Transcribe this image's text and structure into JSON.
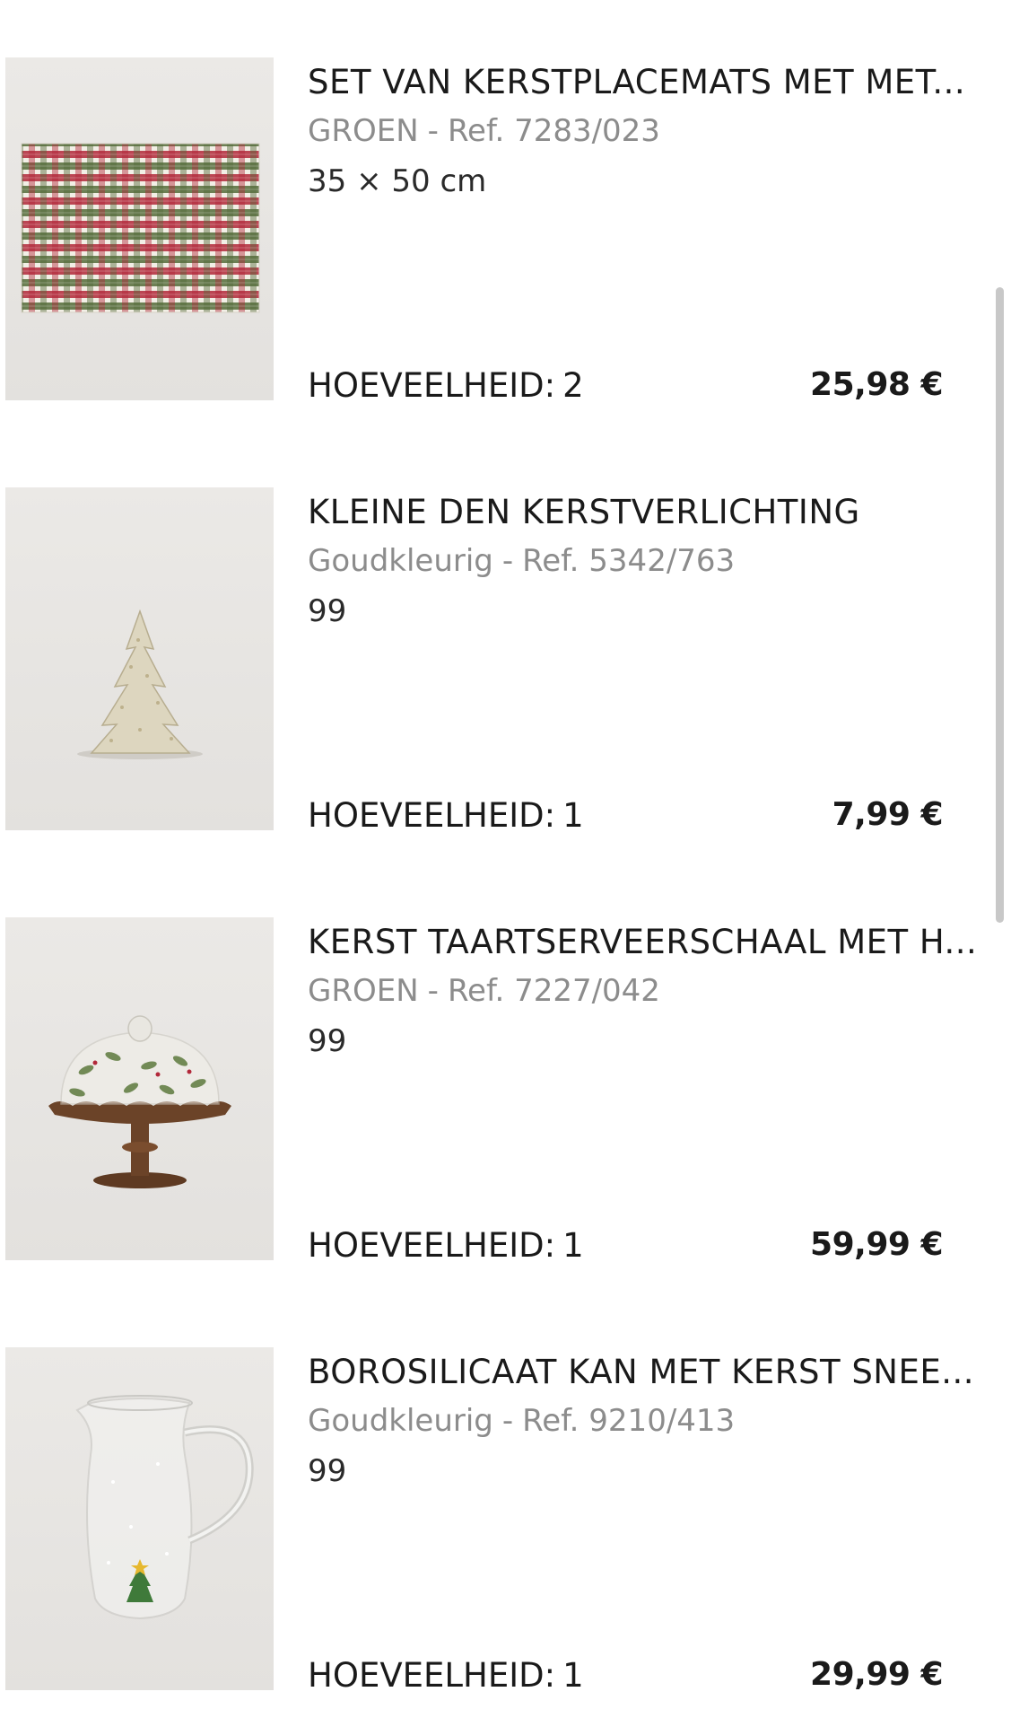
{
  "cart": {
    "quantity_label": "HOEVEELHEID:",
    "items": [
      {
        "name": "SET VAN KERSTPLACEMATS MET MET...",
        "color": "GROEN",
        "separator": "-",
        "ref": "Ref. 7283/023",
        "spec": "35 × 50 cm",
        "quantity": "2",
        "price": "25,98 €",
        "image": "plaid-placemat-image"
      },
      {
        "name": "KLEINE DEN KERSTVERLICHTING",
        "color": "Goudkleurig",
        "separator": "-",
        "ref": "Ref. 5342/763",
        "spec": "99",
        "quantity": "1",
        "price": "7,99 €",
        "image": "ceramic-tree-image"
      },
      {
        "name": "KERST TAARTSERVEERSCHAAL MET H...",
        "color": "GROEN",
        "separator": "-",
        "ref": "Ref. 7227/042",
        "spec": "99",
        "quantity": "1",
        "price": "59,99 €",
        "image": "cake-stand-image"
      },
      {
        "name": "BOROSILICAAT KAN MET KERST SNEE...",
        "color": "Goudkleurig",
        "separator": "-",
        "ref": "Ref. 9210/413",
        "spec": "99",
        "quantity": "1",
        "price": "29,99 €",
        "image": "glass-jug-image"
      }
    ]
  }
}
